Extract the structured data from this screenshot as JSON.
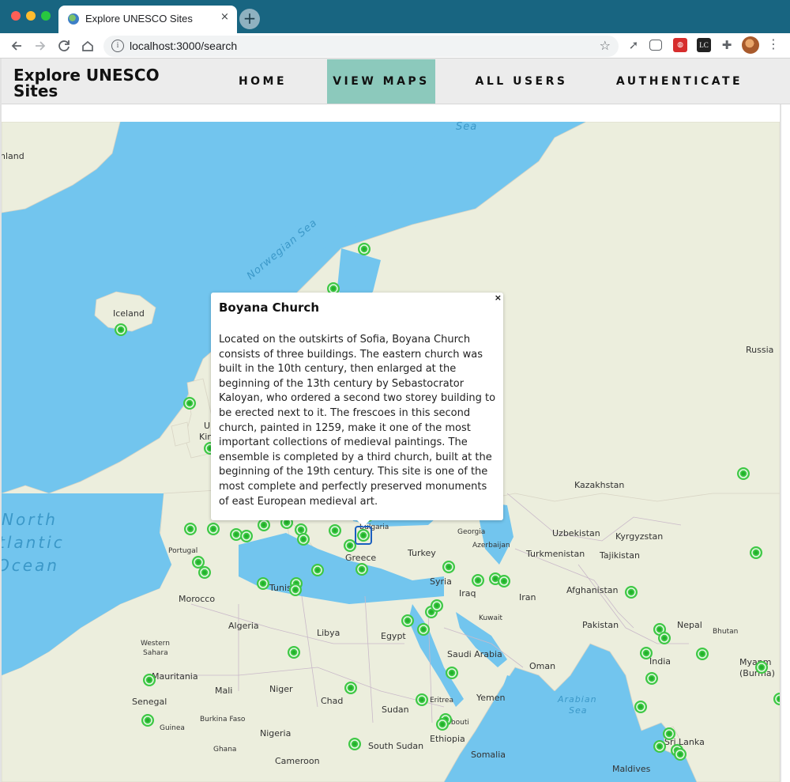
{
  "browser": {
    "tab_title": "Explore UNESCO Sites",
    "tab_close": "×",
    "new_tab": "+",
    "url": "localhost:3000/search",
    "extensions": [
      "rocket-icon",
      "pocket-icon",
      "extension-icon-red",
      "lc-extension-icon",
      "puzzle-icon"
    ]
  },
  "header": {
    "brand": "Explore UNESCO Sites",
    "nav": {
      "home": "HOME",
      "view_maps": "VIEW MAPS",
      "all_users": "ALL USERS",
      "authenticate": "AUTHENTICATE"
    },
    "active_color": "#8cc9bc"
  },
  "popup": {
    "title": "Boyana Church",
    "close": "×",
    "description": "Located on the outskirts of Sofia, Boyana Church consists of three buildings. The eastern church was built in the 10th century, then enlarged at the beginning of the 13th century by Sebastocrator Kaloyan, who ordered a second two storey building to be erected next to it. The frescoes in this second church, painted in 1259, make it one of the most important collections of medieval paintings. The ensemble is completed by a third church, built at the beginning of the 19th century. This site is one of the most complete and perfectly preserved monuments of east European medieval art."
  },
  "map": {
    "water_color": "#72c5ee",
    "land_color": "#eceedd",
    "marker_color": "#3ec845",
    "labels": {
      "finland": "nland",
      "iceland": "Iceland",
      "norwegian_sea": "Norwegian Sea",
      "sea_top": "Sea",
      "russia": "Russia",
      "kazakhstan": "Kazakhstan",
      "uzbekistan": "Uzbekistan",
      "kyrgyzstan": "Kyrgyzstan",
      "turkmenistan": "Turkmenistan",
      "tajikistan": "Tajikistan",
      "georgia": "Georgia",
      "azerbaijan": "Azerbaijan",
      "turkey": "Turkey",
      "greece": "Greece",
      "bulgaria": "Bulgaria",
      "syria": "Syria",
      "iraq": "Iraq",
      "iran": "Iran",
      "afghanistan": "Afghanistan",
      "pakistan": "Pakistan",
      "nepal": "Nepal",
      "bhutan": "Bhutan",
      "india": "India",
      "myanmar_1": "Myanm",
      "myanmar_2": "(Burma)",
      "kuwait": "Kuwait",
      "saudi_arabia": "Saudi Arabia",
      "oman": "Oman",
      "yemen": "Yemen",
      "egypt": "Egypt",
      "libya": "Libya",
      "algeria": "Algeria",
      "tunisia": "Tunis",
      "morocco": "Morocco",
      "portugal": "Portugal",
      "western_sahara_1": "Western",
      "western_sahara_2": "Sahara",
      "mauritania": "Mauritania",
      "mali": "Mali",
      "niger": "Niger",
      "chad": "Chad",
      "sudan": "Sudan",
      "senegal": "Senegal",
      "guinea": "Guinea",
      "burkina_faso": "Burkina Faso",
      "nigeria": "Nigeria",
      "ghana": "Ghana",
      "cameroon": "Cameroon",
      "south_sudan": "South Sudan",
      "ethiopia": "Ethiopia",
      "eritrea": "Eritrea",
      "djibouti": "Djibouti",
      "somalia": "Somalia",
      "arabian_sea_1": "Arabian",
      "arabian_sea_2": "Sea",
      "sri_lanka": "Sri Lanka",
      "maldives": "Maldives",
      "north_atlantic_1": "North",
      "north_atlantic_2": "tlantic",
      "north_atlantic_3": "Ocean",
      "uk_1": "U",
      "uk_2": "Kin"
    }
  }
}
